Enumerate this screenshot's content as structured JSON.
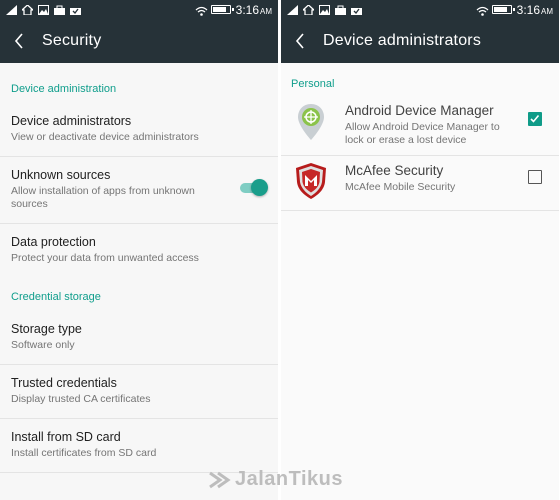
{
  "left": {
    "status": {
      "time": "3:16",
      "ampm": "AM",
      "battery_level": 0.85
    },
    "title": "Security",
    "sections": [
      {
        "header": "Device administration",
        "items": [
          {
            "title": "Device administrators",
            "subtitle": "View or deactivate device administrators"
          },
          {
            "title": "Unknown sources",
            "subtitle": "Allow installation of apps from unknown sources",
            "toggle": true
          },
          {
            "title": "Data protection",
            "subtitle": "Protect your data from unwanted access"
          }
        ]
      },
      {
        "header": "Credential storage",
        "items": [
          {
            "title": "Storage type",
            "subtitle": "Software only"
          },
          {
            "title": "Trusted credentials",
            "subtitle": "Display trusted CA certificates"
          },
          {
            "title": "Install from SD card",
            "subtitle": "Install certificates from SD card"
          }
        ]
      }
    ]
  },
  "right": {
    "status": {
      "time": "3:16",
      "ampm": "AM",
      "battery_level": 0.85
    },
    "title": "Device administrators",
    "section": "Personal",
    "admins": [
      {
        "title": "Android Device Manager",
        "subtitle": "Allow Android Device Manager to lock or erase a lost device",
        "checked": true,
        "icon": "android-device-manager-icon"
      },
      {
        "title": "McAfee Security",
        "subtitle": "McAfee Mobile Security",
        "checked": false,
        "icon": "mcafee-shield-icon"
      }
    ]
  },
  "watermark": "JalanTikus",
  "colors": {
    "toolbar": "#263238",
    "accent": "#109e8c"
  }
}
